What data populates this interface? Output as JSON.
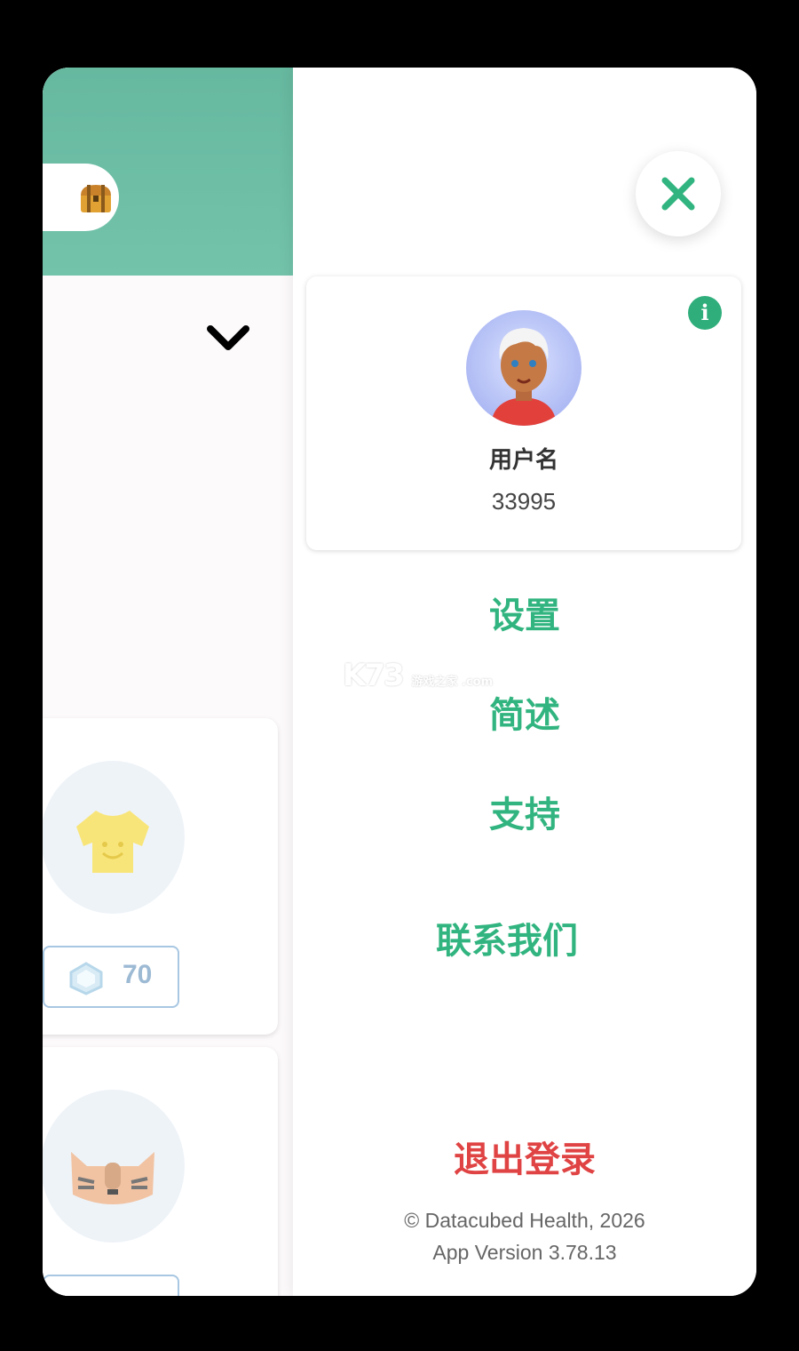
{
  "profile": {
    "username": "用户名",
    "user_id": "33995"
  },
  "menu": {
    "items": [
      {
        "label": "设置"
      },
      {
        "label": "简述"
      },
      {
        "label": "支持"
      },
      {
        "label": "联系我们"
      }
    ],
    "logout": "退出登录"
  },
  "footer": {
    "copyright": "© Datacubed Health, 2026",
    "version": "App Version 3.78.13"
  },
  "background": {
    "item_price": "70"
  },
  "watermark": {
    "brand": "K73",
    "sub": "游戏之家 .com"
  },
  "colors": {
    "accent_green": "#31b47f",
    "logout_red": "#e04343",
    "header_teal": "#6dbea4"
  },
  "icons": [
    "close-icon",
    "info-icon",
    "chevron-down-icon",
    "treasure-chest-icon",
    "gem-icon"
  ]
}
